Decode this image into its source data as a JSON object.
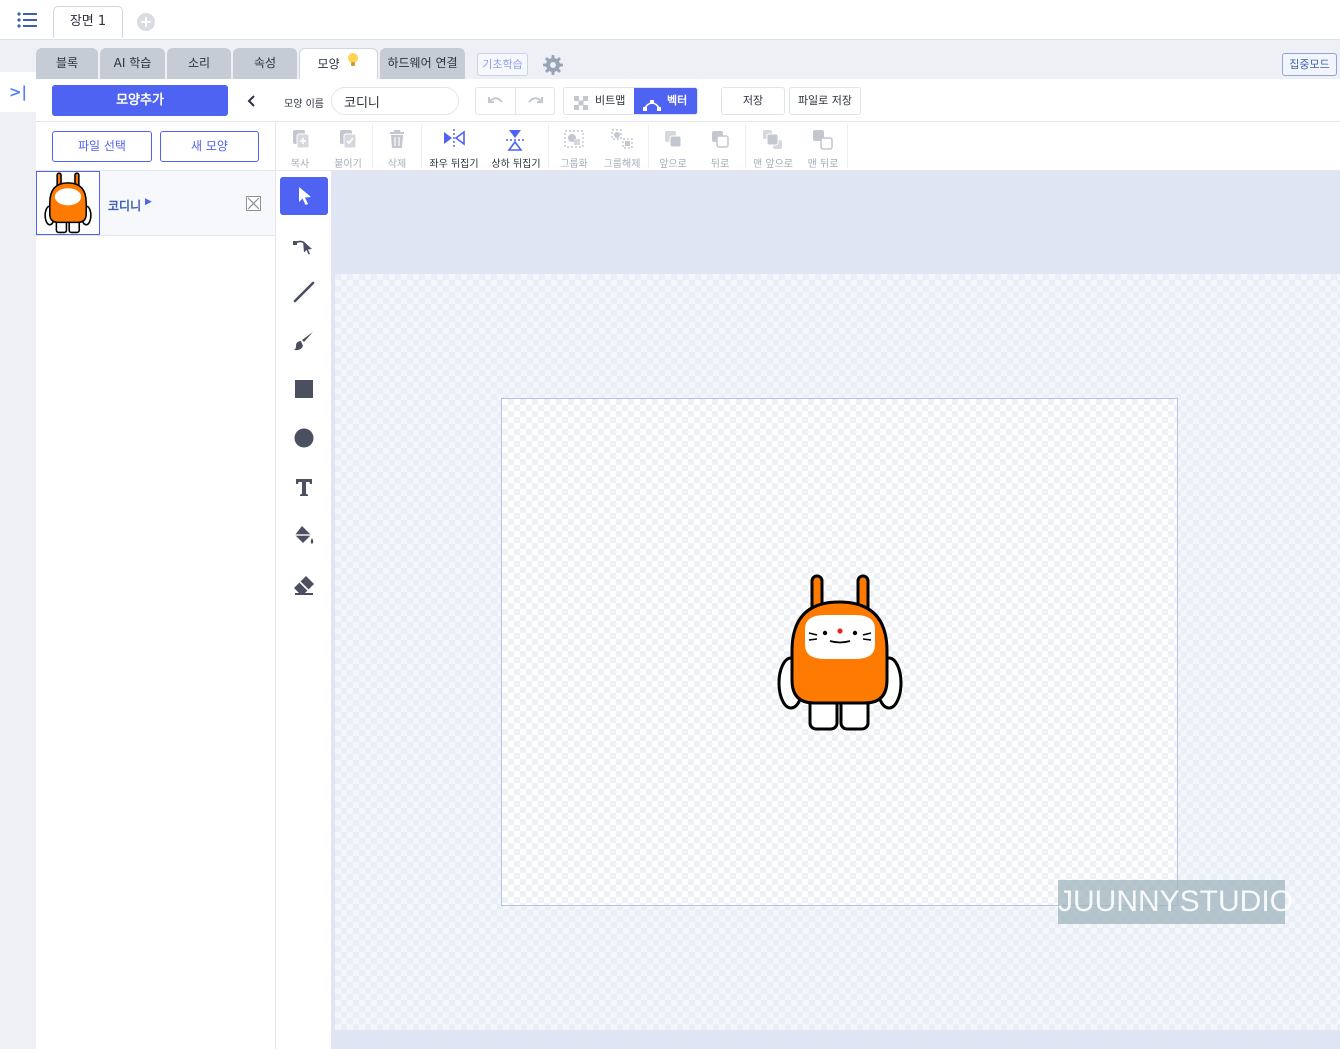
{
  "scene_bar": {
    "scene_tab": "장면 1",
    "add_scene": "+"
  },
  "tabs": [
    {
      "label": "블록",
      "active": false
    },
    {
      "label": "AI 학습",
      "active": false
    },
    {
      "label": "소리",
      "active": false
    },
    {
      "label": "속성",
      "active": false
    },
    {
      "label": "모양",
      "active": true
    },
    {
      "label": "하드웨어 연결",
      "active": false
    }
  ],
  "tab_extras": {
    "basics": "기초학습",
    "focus_mode": "집중모드"
  },
  "shape_bar": {
    "add_shape": "모양추가",
    "name_label": "모양 이름",
    "name_value": "코디니",
    "bitmap": "비트맵",
    "vector": "벡터",
    "save": "저장",
    "save_file": "파일로 저장"
  },
  "shape_panel": {
    "file_select": "파일 선택",
    "new_shape": "새 모양",
    "items": [
      {
        "name": "코디니"
      }
    ]
  },
  "edit_toolbar": [
    {
      "label": "복사",
      "enabled": false,
      "icon": "copy-icon"
    },
    {
      "label": "붙이기",
      "enabled": false,
      "icon": "paste-icon"
    },
    {
      "label": "삭제",
      "enabled": false,
      "icon": "trash-icon"
    },
    {
      "label": "좌우 뒤집기",
      "enabled": true,
      "icon": "flip-horizontal-icon"
    },
    {
      "label": "상하 뒤집기",
      "enabled": true,
      "icon": "flip-vertical-icon"
    },
    {
      "label": "그룹화",
      "enabled": false,
      "icon": "group-icon"
    },
    {
      "label": "그룹해제",
      "enabled": false,
      "icon": "ungroup-icon"
    },
    {
      "label": "앞으로",
      "enabled": false,
      "icon": "bring-forward-icon"
    },
    {
      "label": "뒤로",
      "enabled": false,
      "icon": "send-backward-icon"
    },
    {
      "label": "맨 앞으로",
      "enabled": false,
      "icon": "bring-to-front-icon"
    },
    {
      "label": "맨 뒤로",
      "enabled": false,
      "icon": "send-to-back-icon"
    }
  ],
  "tools": [
    "select-icon",
    "reshape-icon",
    "line-icon",
    "brush-icon",
    "rectangle-icon",
    "ellipse-icon",
    "text-icon",
    "fill-icon",
    "eraser-icon"
  ],
  "watermark": "JUUNNYSTUDIO",
  "colors": {
    "accent": "#4f63f2",
    "character_orange": "#ff7a00"
  }
}
